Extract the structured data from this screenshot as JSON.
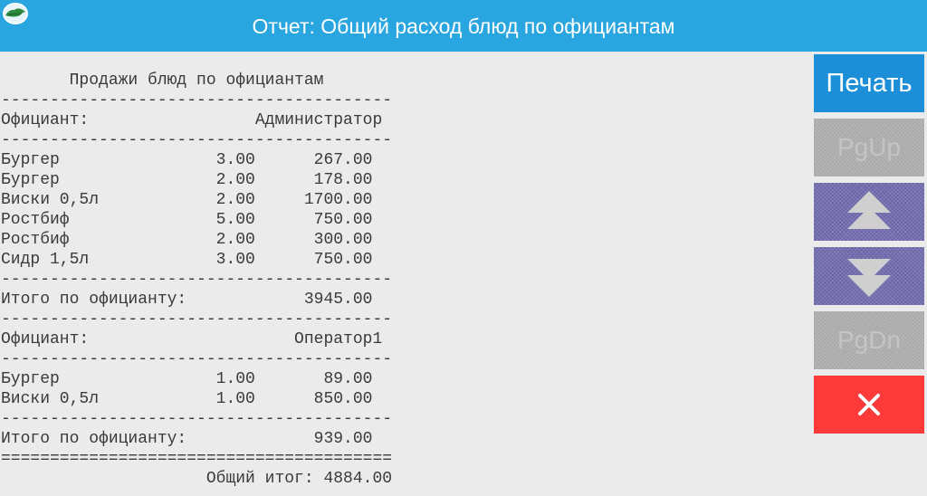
{
  "window": {
    "title": "Отчет: Общий расход блюд по официантам",
    "icon": "app-logo-icon"
  },
  "report": {
    "lines": [
      "       Продажи блюд по официантам",
      "----------------------------------------",
      "Официант:                 Администратор",
      "----------------------------------------",
      "Бургер                3.00      267.00",
      "Бургер                2.00      178.00",
      "Виски 0,5л            2.00     1700.00",
      "Ростбиф               5.00      750.00",
      "Ростбиф               2.00      300.00",
      "Сидр 1,5л             3.00      750.00",
      "----------------------------------------",
      "Итого по официанту:            3945.00",
      "----------------------------------------",
      "Официант:                     Оператор1",
      "----------------------------------------",
      "Бургер                1.00       89.00",
      "Виски 0,5л            1.00      850.00",
      "----------------------------------------",
      "Итого по официанту:             939.00",
      "========================================",
      "                     Общий итог: 4884.00"
    ]
  },
  "toolbar": {
    "print_label": "Печать",
    "pgup_label": "PgUp",
    "pgdn_label": "PgDn",
    "up_icon": "arrow-up-icon",
    "down_icon": "arrow-down-icon",
    "close_icon": "close-icon"
  },
  "colors": {
    "titlebar": "#29a6e0",
    "print": "#1d8fd8",
    "disabled": "#a9a9a9",
    "nav": "#6a65a8",
    "close": "#fd3a3a"
  }
}
